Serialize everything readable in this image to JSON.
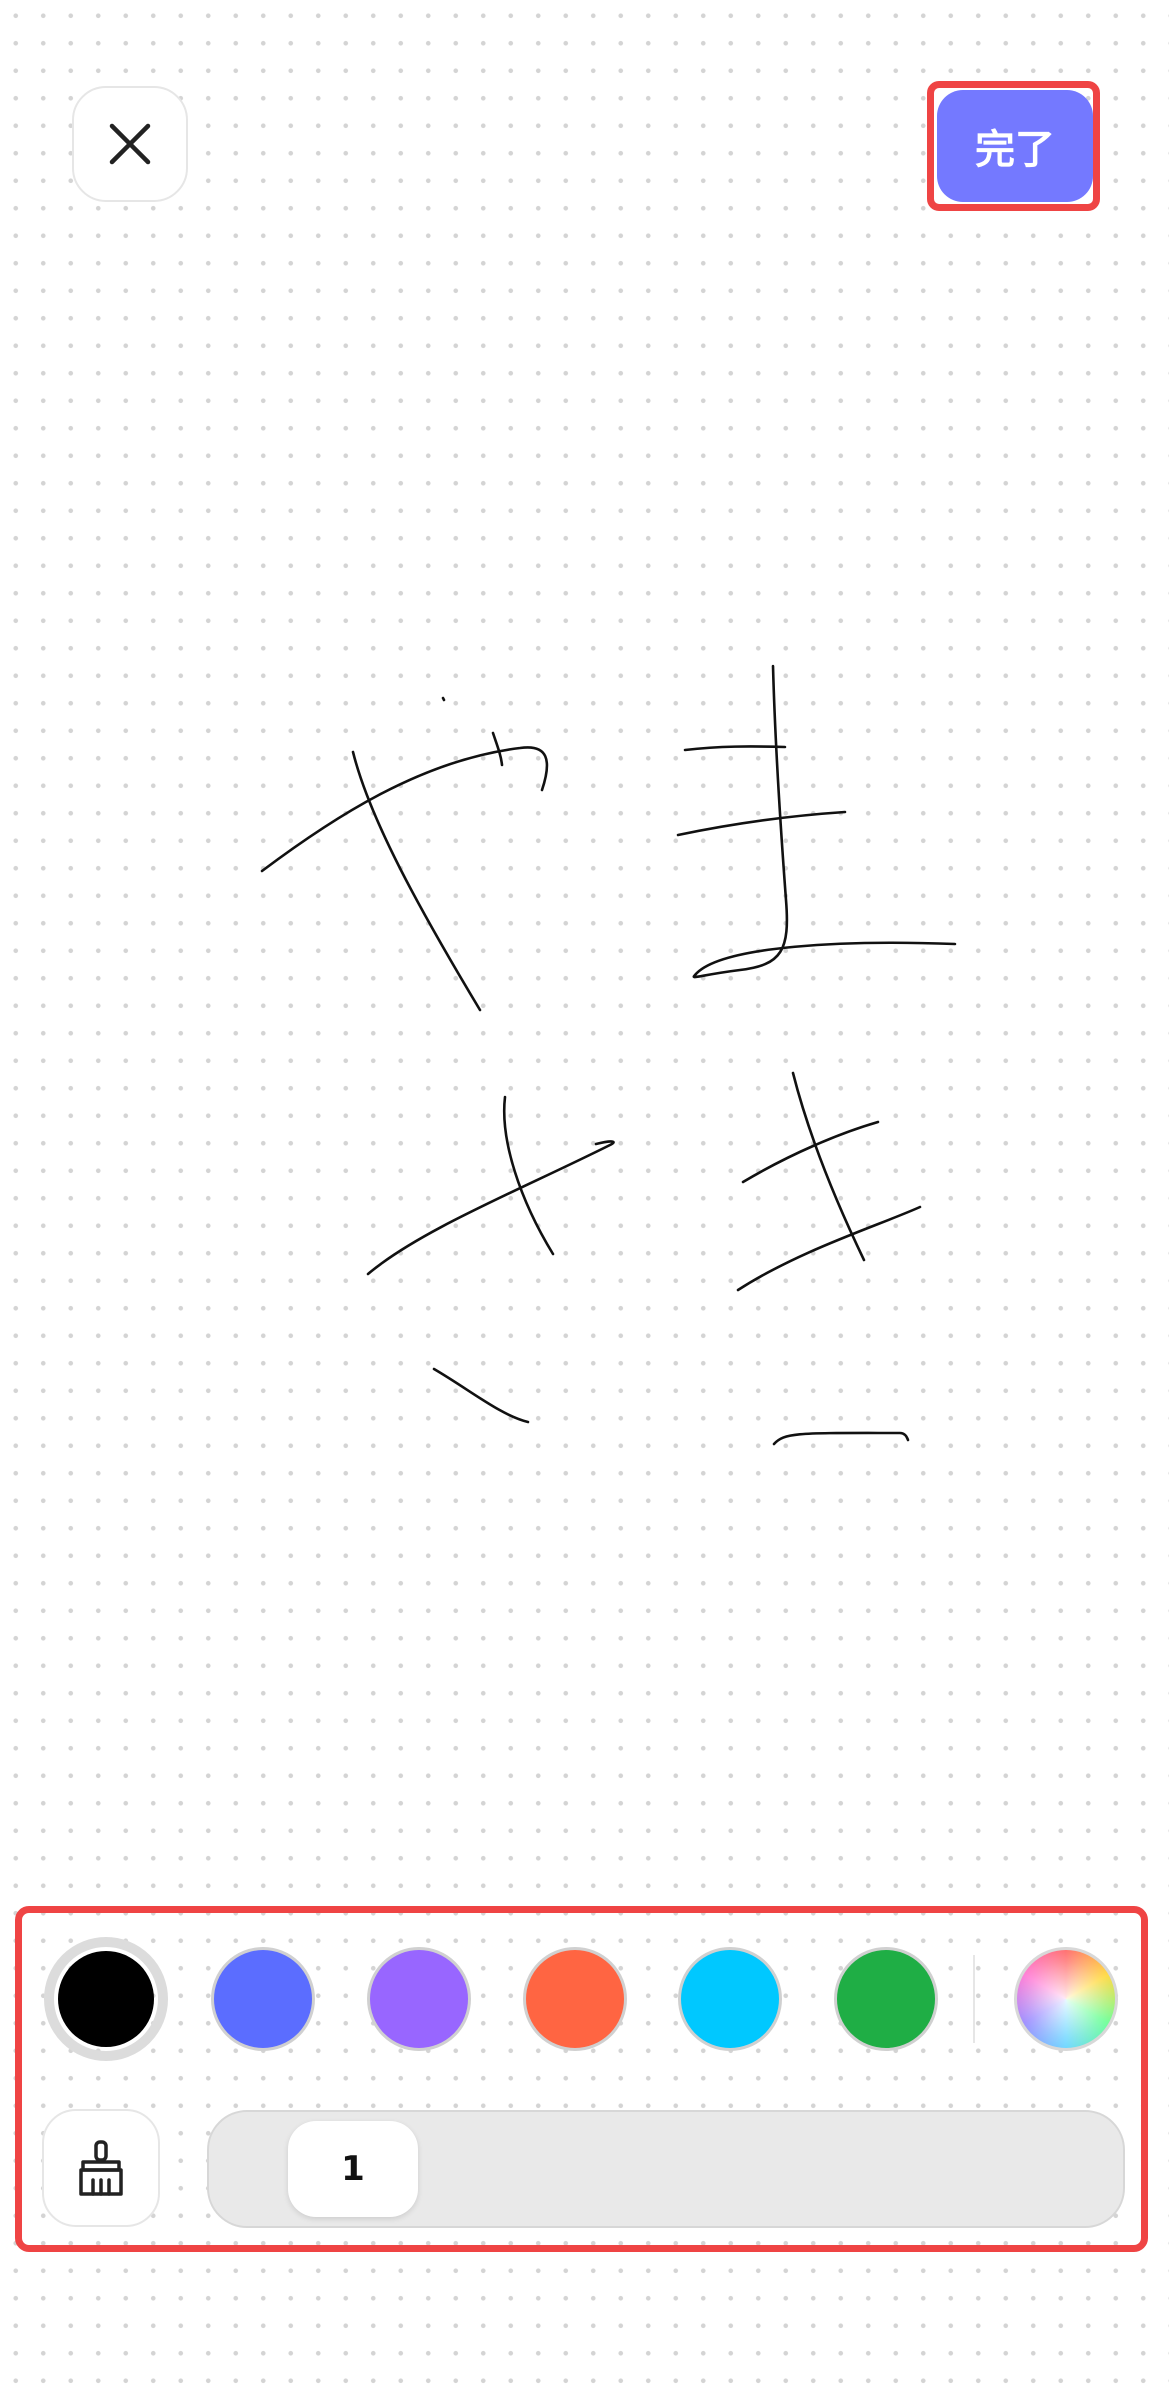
{
  "header": {
    "close_icon": "close-icon",
    "done_label": "完了",
    "done_color": "#7479ff"
  },
  "palette": {
    "colors": [
      {
        "name": "black",
        "hex": "#000000",
        "selected": true
      },
      {
        "name": "blue",
        "hex": "#5b6dff",
        "selected": false
      },
      {
        "name": "purple",
        "hex": "#9866ff",
        "selected": false
      },
      {
        "name": "orange",
        "hex": "#ff6542",
        "selected": false
      },
      {
        "name": "cyan",
        "hex": "#00c8ff",
        "selected": false
      },
      {
        "name": "green",
        "hex": "#1fae45",
        "selected": false
      }
    ],
    "custom_color_icon": "color-wheel-icon"
  },
  "brush": {
    "eraser_icon": "broom-icon",
    "size_value": "1"
  },
  "highlight_color": "#ef4444"
}
